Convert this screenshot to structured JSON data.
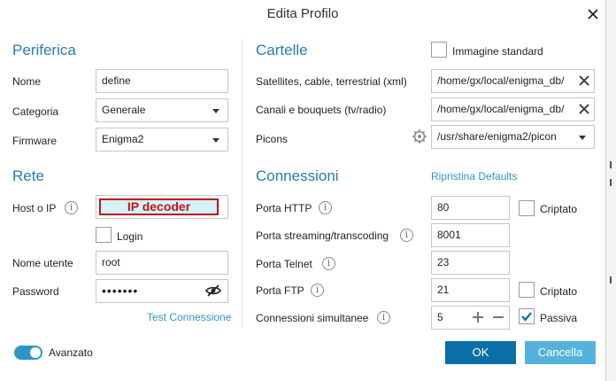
{
  "window": {
    "title": "Edita Profilo"
  },
  "device": {
    "heading": "Periferica",
    "name_label": "Nome",
    "name_value": "define",
    "category_label": "Categoria",
    "category_value": "Generale",
    "firmware_label": "Firmware",
    "firmware_value": "Enigma2"
  },
  "network": {
    "heading": "Rete",
    "host_label": "Host o IP",
    "host_value": "IP decoder",
    "login_label": "Login",
    "username_label": "Nome utente",
    "username_value": "root",
    "password_label": "Password",
    "password_value": "•••••••",
    "test_link": "Test Connessione"
  },
  "folders": {
    "heading": "Cartelle",
    "standard_image_label": "Immagine standard",
    "satellites_label": "Satellites, cable, terrestrial (xml)",
    "satellites_value": "/home/gx/local/enigma_db/",
    "channels_label": "Canali e bouquets (tv/radio)",
    "channels_value": "/home/gx/local/enigma_db/",
    "picons_label": "Picons",
    "picons_value": "/usr/share/enigma2/picon"
  },
  "connections": {
    "heading": "Connessioni",
    "restore_link": "Ripristina Defaults",
    "http_label": "Porta HTTP",
    "http_value": "80",
    "encrypted_label": "Criptato",
    "streaming_label": "Porta streaming/transcoding",
    "streaming_value": "8001",
    "telnet_label": "Porta Telnet",
    "telnet_value": "23",
    "ftp_label": "Porta FTP",
    "ftp_value": "21",
    "ftp_encrypted_label": "Criptato",
    "simultaneous_label": "Connessioni simultanee",
    "simultaneous_value": "5",
    "passive_label": "Passiva"
  },
  "footer": {
    "advanced_label": "Avanzato",
    "ok_label": "OK",
    "cancel_label": "Cancella"
  },
  "colors": {
    "accent": "#2a7ab0",
    "ok_button": "#0a6fa6",
    "cancel_button": "#55b2dc",
    "highlight": "#c0121a"
  },
  "icons": [
    "close-icon",
    "info-icon",
    "caret-down-icon",
    "clear-icon",
    "gear-icon",
    "eye-hidden-icon",
    "plus-icon",
    "minus-icon",
    "checkmark-icon"
  ]
}
